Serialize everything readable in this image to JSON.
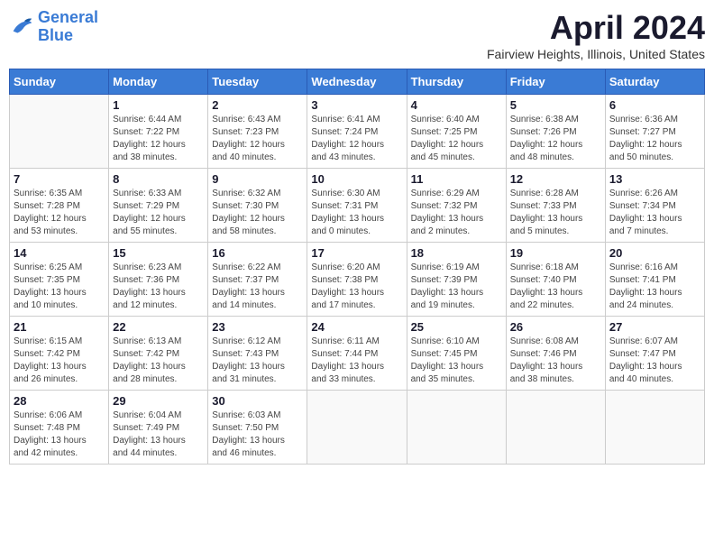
{
  "logo": {
    "line1": "General",
    "line2": "Blue"
  },
  "title": "April 2024",
  "subtitle": "Fairview Heights, Illinois, United States",
  "weekdays": [
    "Sunday",
    "Monday",
    "Tuesday",
    "Wednesday",
    "Thursday",
    "Friday",
    "Saturday"
  ],
  "weeks": [
    [
      {
        "day": "",
        "info": ""
      },
      {
        "day": "1",
        "info": "Sunrise: 6:44 AM\nSunset: 7:22 PM\nDaylight: 12 hours\nand 38 minutes."
      },
      {
        "day": "2",
        "info": "Sunrise: 6:43 AM\nSunset: 7:23 PM\nDaylight: 12 hours\nand 40 minutes."
      },
      {
        "day": "3",
        "info": "Sunrise: 6:41 AM\nSunset: 7:24 PM\nDaylight: 12 hours\nand 43 minutes."
      },
      {
        "day": "4",
        "info": "Sunrise: 6:40 AM\nSunset: 7:25 PM\nDaylight: 12 hours\nand 45 minutes."
      },
      {
        "day": "5",
        "info": "Sunrise: 6:38 AM\nSunset: 7:26 PM\nDaylight: 12 hours\nand 48 minutes."
      },
      {
        "day": "6",
        "info": "Sunrise: 6:36 AM\nSunset: 7:27 PM\nDaylight: 12 hours\nand 50 minutes."
      }
    ],
    [
      {
        "day": "7",
        "info": "Sunrise: 6:35 AM\nSunset: 7:28 PM\nDaylight: 12 hours\nand 53 minutes."
      },
      {
        "day": "8",
        "info": "Sunrise: 6:33 AM\nSunset: 7:29 PM\nDaylight: 12 hours\nand 55 minutes."
      },
      {
        "day": "9",
        "info": "Sunrise: 6:32 AM\nSunset: 7:30 PM\nDaylight: 12 hours\nand 58 minutes."
      },
      {
        "day": "10",
        "info": "Sunrise: 6:30 AM\nSunset: 7:31 PM\nDaylight: 13 hours\nand 0 minutes."
      },
      {
        "day": "11",
        "info": "Sunrise: 6:29 AM\nSunset: 7:32 PM\nDaylight: 13 hours\nand 2 minutes."
      },
      {
        "day": "12",
        "info": "Sunrise: 6:28 AM\nSunset: 7:33 PM\nDaylight: 13 hours\nand 5 minutes."
      },
      {
        "day": "13",
        "info": "Sunrise: 6:26 AM\nSunset: 7:34 PM\nDaylight: 13 hours\nand 7 minutes."
      }
    ],
    [
      {
        "day": "14",
        "info": "Sunrise: 6:25 AM\nSunset: 7:35 PM\nDaylight: 13 hours\nand 10 minutes."
      },
      {
        "day": "15",
        "info": "Sunrise: 6:23 AM\nSunset: 7:36 PM\nDaylight: 13 hours\nand 12 minutes."
      },
      {
        "day": "16",
        "info": "Sunrise: 6:22 AM\nSunset: 7:37 PM\nDaylight: 13 hours\nand 14 minutes."
      },
      {
        "day": "17",
        "info": "Sunrise: 6:20 AM\nSunset: 7:38 PM\nDaylight: 13 hours\nand 17 minutes."
      },
      {
        "day": "18",
        "info": "Sunrise: 6:19 AM\nSunset: 7:39 PM\nDaylight: 13 hours\nand 19 minutes."
      },
      {
        "day": "19",
        "info": "Sunrise: 6:18 AM\nSunset: 7:40 PM\nDaylight: 13 hours\nand 22 minutes."
      },
      {
        "day": "20",
        "info": "Sunrise: 6:16 AM\nSunset: 7:41 PM\nDaylight: 13 hours\nand 24 minutes."
      }
    ],
    [
      {
        "day": "21",
        "info": "Sunrise: 6:15 AM\nSunset: 7:42 PM\nDaylight: 13 hours\nand 26 minutes."
      },
      {
        "day": "22",
        "info": "Sunrise: 6:13 AM\nSunset: 7:42 PM\nDaylight: 13 hours\nand 28 minutes."
      },
      {
        "day": "23",
        "info": "Sunrise: 6:12 AM\nSunset: 7:43 PM\nDaylight: 13 hours\nand 31 minutes."
      },
      {
        "day": "24",
        "info": "Sunrise: 6:11 AM\nSunset: 7:44 PM\nDaylight: 13 hours\nand 33 minutes."
      },
      {
        "day": "25",
        "info": "Sunrise: 6:10 AM\nSunset: 7:45 PM\nDaylight: 13 hours\nand 35 minutes."
      },
      {
        "day": "26",
        "info": "Sunrise: 6:08 AM\nSunset: 7:46 PM\nDaylight: 13 hours\nand 38 minutes."
      },
      {
        "day": "27",
        "info": "Sunrise: 6:07 AM\nSunset: 7:47 PM\nDaylight: 13 hours\nand 40 minutes."
      }
    ],
    [
      {
        "day": "28",
        "info": "Sunrise: 6:06 AM\nSunset: 7:48 PM\nDaylight: 13 hours\nand 42 minutes."
      },
      {
        "day": "29",
        "info": "Sunrise: 6:04 AM\nSunset: 7:49 PM\nDaylight: 13 hours\nand 44 minutes."
      },
      {
        "day": "30",
        "info": "Sunrise: 6:03 AM\nSunset: 7:50 PM\nDaylight: 13 hours\nand 46 minutes."
      },
      {
        "day": "",
        "info": ""
      },
      {
        "day": "",
        "info": ""
      },
      {
        "day": "",
        "info": ""
      },
      {
        "day": "",
        "info": ""
      }
    ]
  ]
}
